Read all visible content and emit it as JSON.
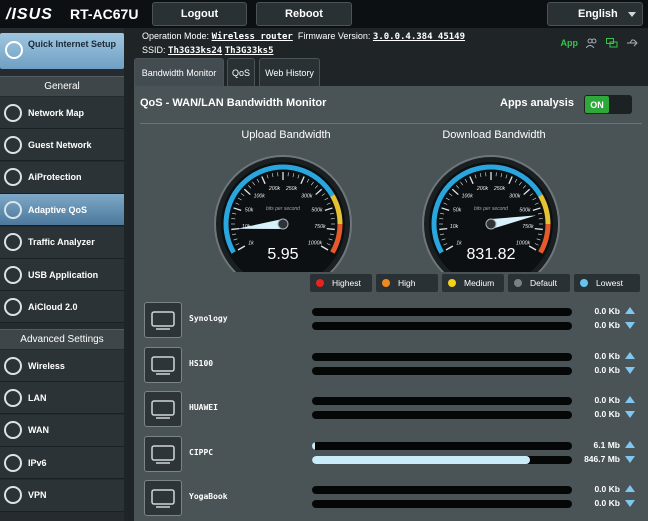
{
  "header": {
    "logo": "/ISUS",
    "model": "RT-AC67U",
    "logout_label": "Logout",
    "reboot_label": "Reboot",
    "language": "English"
  },
  "info": {
    "op_mode_label": "Operation Mode:",
    "op_mode_value": "Wireless router",
    "fw_label": "Firmware Version:",
    "fw_value": "3.0.0.4.384_45149",
    "ssid_label": "SSID:",
    "ssid_1": "Th3G33ks24",
    "ssid_2": "Th3G33ks5",
    "app_label": "App"
  },
  "sidebar": {
    "quick_setup": "Quick Internet Setup",
    "general_head": "General",
    "general": [
      {
        "label": "Network Map"
      },
      {
        "label": "Guest Network"
      },
      {
        "label": "AiProtection"
      },
      {
        "label": "Adaptive QoS"
      },
      {
        "label": "Traffic Analyzer"
      },
      {
        "label": "USB Application"
      },
      {
        "label": "AiCloud 2.0"
      }
    ],
    "advanced_head": "Advanced Settings",
    "advanced": [
      {
        "label": "Wireless"
      },
      {
        "label": "LAN"
      },
      {
        "label": "WAN"
      },
      {
        "label": "IPv6"
      },
      {
        "label": "VPN"
      }
    ]
  },
  "tabs": [
    {
      "label": "Bandwidth Monitor"
    },
    {
      "label": "QoS"
    },
    {
      "label": "Web History"
    }
  ],
  "panel": {
    "title": "QoS - WAN/LAN Bandwidth Monitor",
    "apps_label": "Apps analysis",
    "toggle_label": "ON",
    "upload_title": "Upload Bandwidth",
    "download_title": "Download Bandwidth",
    "upload_value": "5.95",
    "download_value": "831.82",
    "upload_fraction": 0.1,
    "download_fraction": 0.83,
    "gauge_caption": "bits per second",
    "gauge_ticks": [
      "1k",
      "10k",
      "50k",
      "100k",
      "200k",
      "250k",
      "300k",
      "500k",
      "750k",
      "1000k"
    ]
  },
  "legend": [
    {
      "label": "Highest",
      "color": "#e8221f"
    },
    {
      "label": "High",
      "color": "#f08a1c"
    },
    {
      "label": "Medium",
      "color": "#f2d21a"
    },
    {
      "label": "Default",
      "color": "#7b8083"
    },
    {
      "label": "Lowest",
      "color": "#66c3ef"
    }
  ],
  "clients": [
    {
      "name": "Synology",
      "up": "0.0",
      "up_unit": "Kb",
      "down": "0.0",
      "down_unit": "Kb",
      "up_level": 0,
      "down_level": 0
    },
    {
      "name": "HS100",
      "up": "0.0",
      "up_unit": "Kb",
      "down": "0.0",
      "down_unit": "Kb",
      "up_level": 0,
      "down_level": 0
    },
    {
      "name": "HUAWEI",
      "up": "0.0",
      "up_unit": "Kb",
      "down": "0.0",
      "down_unit": "Kb",
      "up_level": 0,
      "down_level": 0
    },
    {
      "name": "CIPPC",
      "up": "6.1",
      "up_unit": "Mb",
      "down": "846.7",
      "down_unit": "Mb",
      "up_level": 0.01,
      "down_level": 0.84
    },
    {
      "name": "YogaBook",
      "up": "0.0",
      "up_unit": "Kb",
      "down": "0.0",
      "down_unit": "Kb",
      "up_level": 0,
      "down_level": 0
    }
  ]
}
